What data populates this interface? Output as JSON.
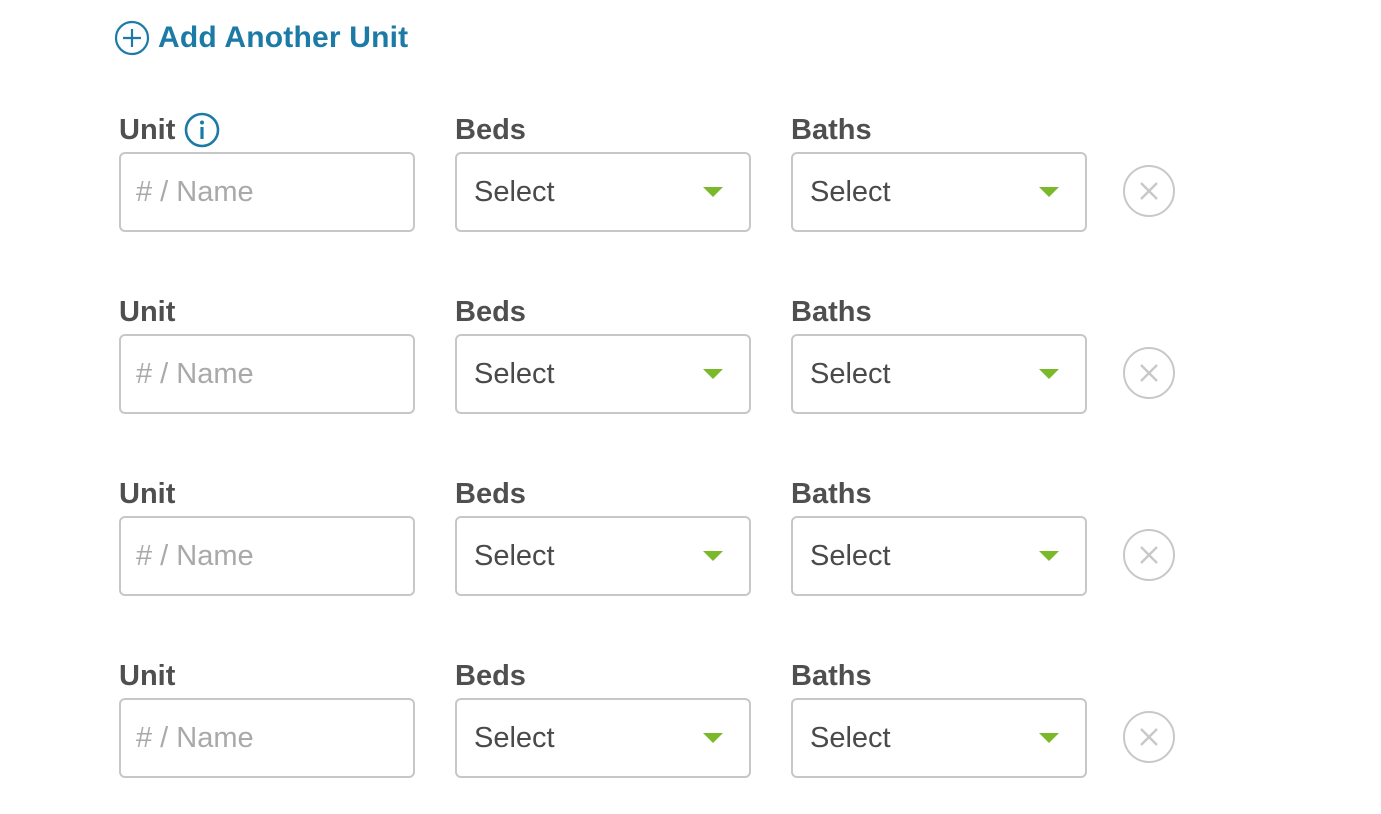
{
  "add_unit": {
    "label": "Add Another Unit",
    "icon": "plus-circle-icon"
  },
  "colors": {
    "accent": "#1b7aa6",
    "label_text": "#4f4f4f",
    "input_border": "#c7c7c7",
    "placeholder": "#a9a9a9",
    "caret": "#7ab929",
    "remove_icon": "#c8c8c8"
  },
  "rows": [
    {
      "unit_label": "Unit",
      "unit_placeholder": "# / Name",
      "unit_value": "",
      "beds_label": "Beds",
      "beds_value": "Select",
      "baths_label": "Baths",
      "baths_value": "Select",
      "has_info_icon": true
    },
    {
      "unit_label": "Unit",
      "unit_placeholder": "# / Name",
      "unit_value": "",
      "beds_label": "Beds",
      "beds_value": "Select",
      "baths_label": "Baths",
      "baths_value": "Select",
      "has_info_icon": false
    },
    {
      "unit_label": "Unit",
      "unit_placeholder": "# / Name",
      "unit_value": "",
      "beds_label": "Beds",
      "beds_value": "Select",
      "baths_label": "Baths",
      "baths_value": "Select",
      "has_info_icon": false
    },
    {
      "unit_label": "Unit",
      "unit_placeholder": "# / Name",
      "unit_value": "",
      "beds_label": "Beds",
      "beds_value": "Select",
      "baths_label": "Baths",
      "baths_value": "Select",
      "has_info_icon": false
    }
  ],
  "icons": {
    "info": "info-icon",
    "caret": "chevron-down-icon",
    "remove": "close-circle-icon"
  }
}
